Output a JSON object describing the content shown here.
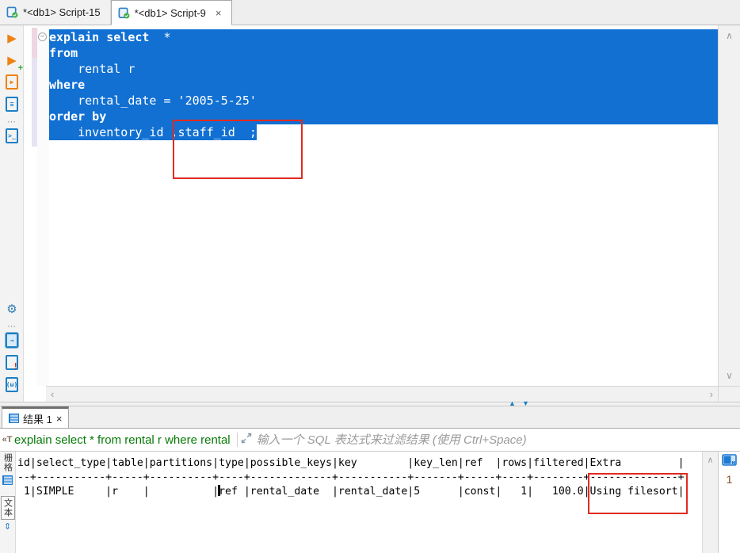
{
  "colors": {
    "selection": "#1170d2",
    "annotation_red": "#e02b20",
    "query_green": "#067a06",
    "row_number": "#8a4b20",
    "toolbar_orange": "#ee8212",
    "toolbar_blue": "#1c7fc4"
  },
  "glyphs": {
    "up": "∧",
    "down": "∨",
    "left": "‹",
    "right": "›",
    "sash_up": "▲",
    "sash_down": "▼",
    "fold_collapse": "−",
    "panels_toggle": "⇕",
    "query_text_icon": "«T"
  },
  "editor_tabs": [
    {
      "label": "*<db1> Script-15"
    },
    {
      "label": "*<db1> Script-9",
      "close": "×"
    }
  ],
  "left_toolbar": {
    "top": [
      {
        "name": "execute-statement-icon",
        "glyph": "▶",
        "color": "#ee8212"
      },
      {
        "name": "execute-statement-new-tab-icon",
        "glyph": "▶",
        "color": "#ee8212",
        "badge": "+",
        "badge_color": "#2ea52e"
      },
      {
        "name": "execute-script-icon",
        "kind": "doc",
        "glyph": "▶",
        "color": "#ee8212"
      },
      {
        "name": "explain-execution-plan-icon",
        "kind": "doc",
        "glyph": "≡",
        "color": "#1c7fc4"
      },
      {
        "name": "toolbar-overflow-icon",
        "glyph": "⋯",
        "color": "#9a9a9a",
        "small": true
      },
      {
        "name": "sql-console-icon",
        "kind": "doc",
        "glyph": ">_",
        "color": "#1c7fc4"
      }
    ],
    "bottom": [
      {
        "name": "settings-gear-icon",
        "glyph": "⚙",
        "color": "#2e7bb4"
      },
      {
        "name": "toolbar-overflow-icon",
        "glyph": "⋯",
        "color": "#9a9a9a",
        "small": true
      },
      {
        "name": "output-panel-icon",
        "kind": "doc",
        "glyph": "→",
        "color": "#1c7fc4",
        "active": true
      },
      {
        "name": "problems-panel-icon",
        "kind": "doc",
        "glyph": "",
        "color": "#1c7fc4",
        "badge": "!",
        "badge_color": "#e02b20"
      },
      {
        "name": "variables-panel-icon",
        "kind": "doc",
        "glyph": "(ω)",
        "color": "#1c7fc4"
      }
    ]
  },
  "editor": {
    "code_lines": [
      {
        "full": true,
        "segs": [
          {
            "t": "explain select",
            "kw": true
          },
          {
            "t": "  *"
          }
        ]
      },
      {
        "full": true,
        "segs": [
          {
            "t": "from",
            "kw": true
          }
        ]
      },
      {
        "full": true,
        "segs": [
          {
            "t": "    rental r"
          }
        ]
      },
      {
        "full": true,
        "segs": [
          {
            "t": "where",
            "kw": true
          }
        ]
      },
      {
        "full": true,
        "segs": [
          {
            "t": "    rental_date = '2005-5-25'"
          }
        ]
      },
      {
        "full": true,
        "segs": [
          {
            "t": "order by",
            "kw": true
          }
        ]
      },
      {
        "full": false,
        "segs": [
          {
            "t": "    inventory_id ,staff_id  ;"
          }
        ]
      }
    ]
  },
  "results": {
    "tab_label": "结果 1",
    "tab_close": "×",
    "query_text": "explain select * from rental r where rental",
    "filter_placeholder": "输入一个 SQL 表达式来过滤结果 (使用 Ctrl+Space)",
    "view_tabs": [
      {
        "label": "栅格"
      },
      {
        "label": "文本"
      }
    ],
    "row_indicator": "1",
    "text_output": {
      "lines": [
        "id|select_type|table|partitions|type|possible_keys|key        |key_len|ref  |rows|filtered|Extra         |",
        "--+-----------+-----+----------+----+-------------+-----------+-------+-----+----+--------+--------------+",
        " 1|SIMPLE     |r    |          |ref |rental_date  |rental_date|5      |const|   1|   100.0|Using filesort|"
      ],
      "caret": {
        "line": 2,
        "col": 32
      }
    }
  }
}
